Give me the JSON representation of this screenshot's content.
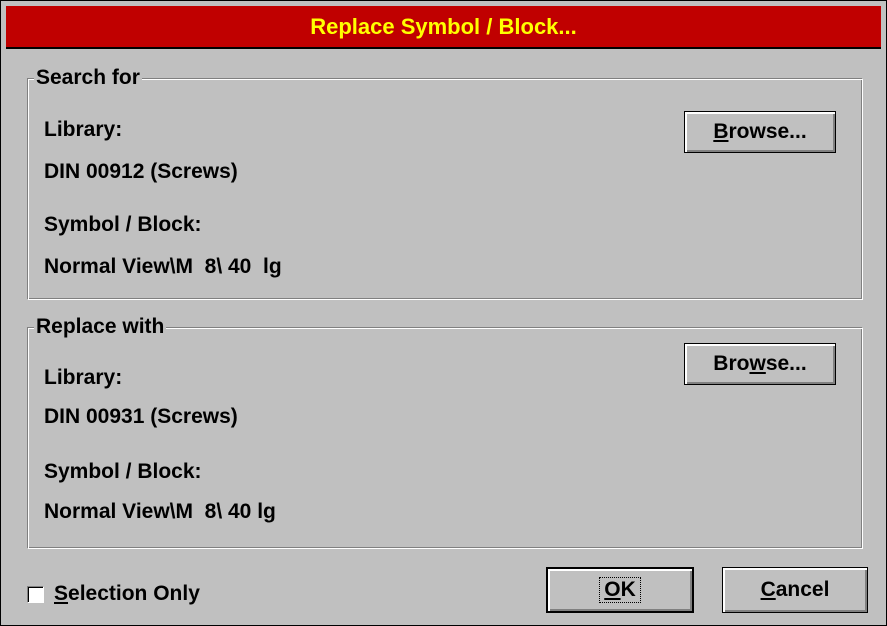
{
  "dialog": {
    "title": "Replace Symbol / Block..."
  },
  "search_for": {
    "group_label": "Search for",
    "library_label": "Library:",
    "library_value": "DIN 00912 (Screws)",
    "symbol_label": "Symbol / Block:",
    "symbol_value": "Normal View\\M  8\\ 40  lg",
    "browse_button": {
      "label": "Browse...",
      "mnemonic": "B"
    }
  },
  "replace_with": {
    "group_label": "Replace with",
    "library_label": "Library:",
    "library_value": "DIN 00931 (Screws)",
    "symbol_label": "Symbol / Block:",
    "symbol_value": "Normal View\\M  8\\ 40 lg",
    "browse_button": {
      "label": "Browse...",
      "mnemonic": "w"
    }
  },
  "selection_only": {
    "label": "Selection Only",
    "mnemonic": "S",
    "checked": false
  },
  "buttons": {
    "ok": {
      "label": "OK",
      "mnemonic": "O"
    },
    "cancel": {
      "label": "Cancel",
      "mnemonic": "C"
    }
  },
  "colors": {
    "title_bar": "#c00000",
    "title_text": "#ffff00",
    "dialog_face": "#c0c0c0"
  }
}
